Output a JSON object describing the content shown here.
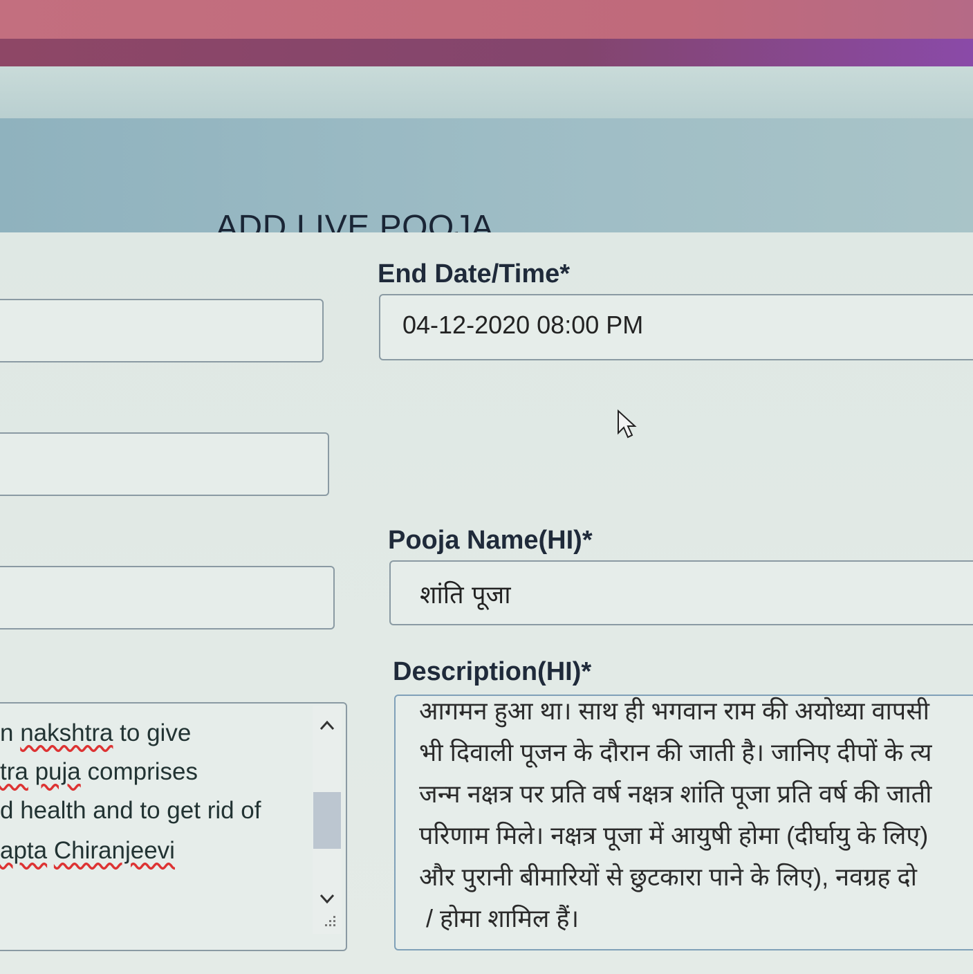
{
  "header": {
    "title": "ADD LIVE POOJA"
  },
  "end_datetime": {
    "label": "End Date/Time*",
    "value": "04-12-2020 08:00 PM"
  },
  "pooja_name_hi": {
    "label": "Pooja Name(HI)*",
    "value": "शांति पूजा"
  },
  "description_hi": {
    "label": "Description(HI)*",
    "lines": [
      "आगमन हुआ था। साथ ही भगवान राम की अयोध्या वापसी",
      "भी दिवाली पूजन के दौरान की जाती है। जानिए दीपों के त्य",
      "जन्म नक्षत्र पर प्रति वर्ष नक्षत्र शांति पूजा प्रति वर्ष की जाती",
      "परिणाम मिले। नक्षत्र पूजा में आयुषी होमा (दीर्घायु के लिए)",
      "और पुरानी बीमारियों से छुटकारा पाने के लिए), नवग्रह दो",
      "/ होमा शामिल हैं।"
    ]
  },
  "description_en": {
    "line1": {
      "pre": "n ",
      "word": "nakshtra",
      "post": " to give"
    },
    "line2": {
      "word1": "tra",
      "word2": "puja",
      "post": " comprises"
    },
    "line3": {
      "text": "d health and to get rid of"
    },
    "line4": {
      "word1": "apta",
      "word2": "Chiranjeevi"
    }
  },
  "icons": {
    "cursor": "mouse-pointer-icon",
    "scroll_up": "chevron-up-icon",
    "scroll_down": "chevron-down-icon",
    "resize": "resize-grip-icon"
  },
  "colors": {
    "header_bg": "#9dbcc5",
    "panel_bg": "#e2ebe7",
    "top_accent": "#8a4aa8"
  }
}
